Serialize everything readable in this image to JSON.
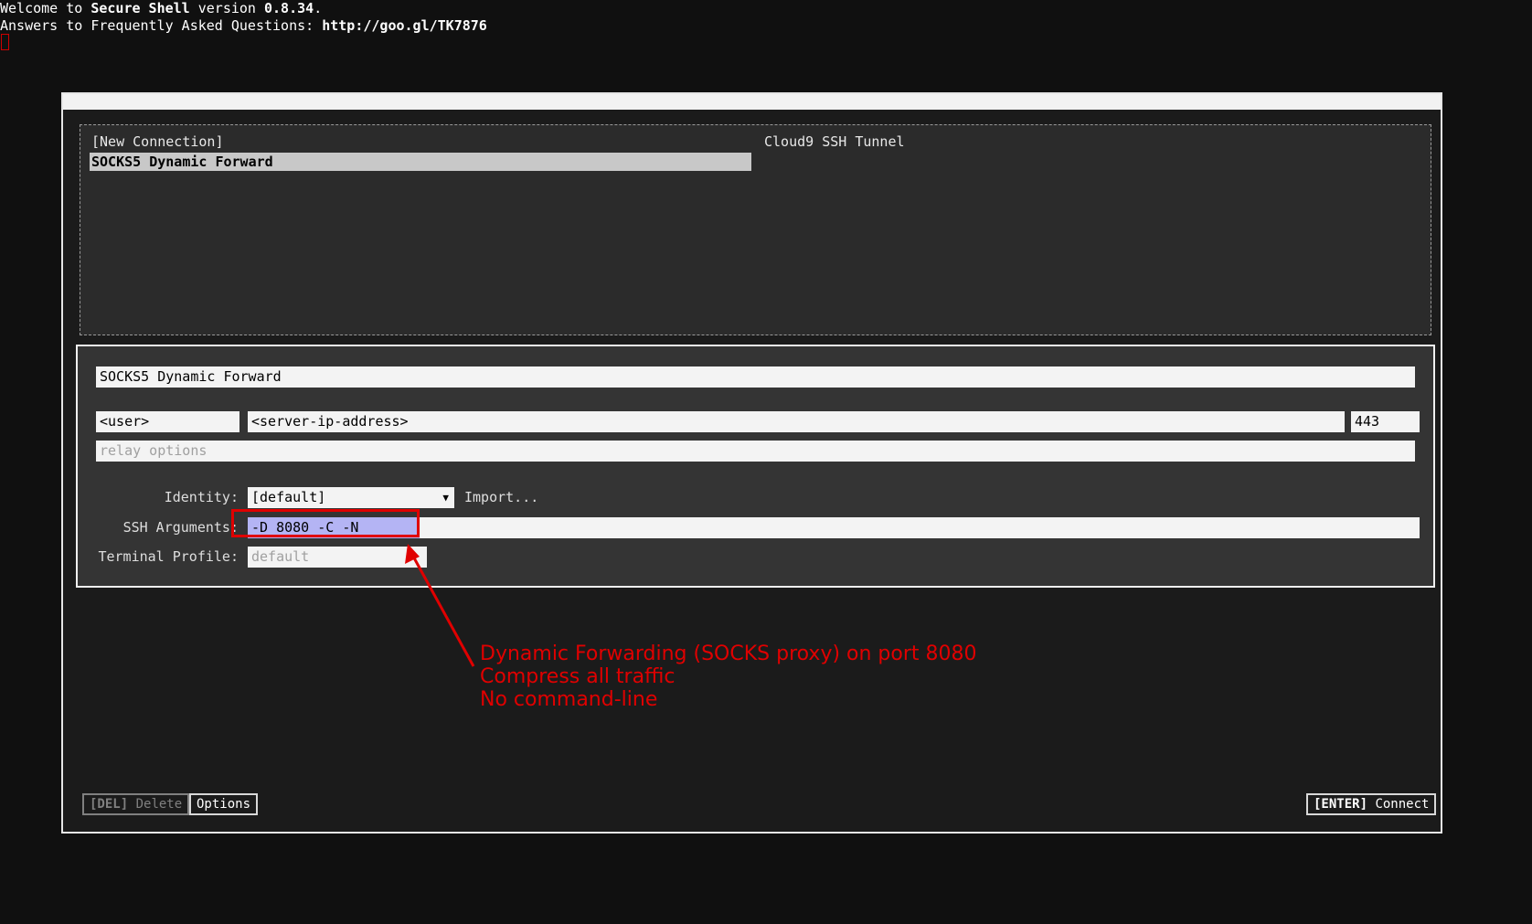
{
  "terminal": {
    "line1_prefix": "Welcome to ",
    "line1_app": "Secure Shell",
    "line1_mid": " version ",
    "line1_version": "0.8.34",
    "line1_suffix": ".",
    "line2_prefix": "Answers to Frequently Asked Questions: ",
    "line2_url": "http://goo.gl/TK7876"
  },
  "connections": {
    "items": [
      {
        "label": "[New Connection]",
        "selected": false
      },
      {
        "label": "SOCKS5 Dynamic Forward",
        "selected": true
      },
      {
        "label": "Cloud9 SSH Tunnel",
        "selected": false
      }
    ]
  },
  "form": {
    "profile_name": "SOCKS5 Dynamic Forward",
    "username": "<user>",
    "hostname": "<server-ip-address>",
    "port": "443",
    "relay_placeholder": "relay options",
    "identity_label": "Identity:",
    "identity_value": "[default]",
    "import_label": "Import...",
    "ssh_args_label": "SSH Arguments:",
    "ssh_args_value": "-D 8080 -C -N",
    "terminal_profile_label": "Terminal Profile:",
    "terminal_profile_placeholder": "default"
  },
  "annotation": {
    "line1": "Dynamic Forwarding (SOCKS proxy) on port 8080",
    "line2": "Compress all traffic",
    "line3": "No command-line",
    "color": "#e00000"
  },
  "buttons": {
    "delete_key": "[DEL]",
    "delete_label": "Delete",
    "options_label": "Options",
    "connect_key": "[ENTER]",
    "connect_label": "Connect"
  }
}
